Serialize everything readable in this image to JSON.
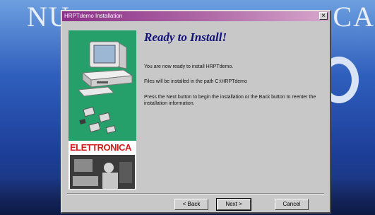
{
  "background": {
    "title_left": "NU",
    "title_right": "CA"
  },
  "dialog": {
    "title": "HRPTdemo Installation",
    "close_glyph": "×",
    "heading": "Ready to Install!",
    "paragraphs": [
      "You are now ready to install HRPTdemo.",
      "Files will be installed in the path  C:\\HRPTdemo",
      "Press the Next button to begin the installation or the Back button to reenter the installation information."
    ],
    "magazine_name": "ELETTRONICA",
    "buttons": {
      "back": "< Back",
      "next": "Next >",
      "cancel": "Cancel"
    }
  },
  "colors": {
    "titlebar_start": "#8a2f88",
    "heading": "#12127a",
    "panel_green": "#26a06a",
    "magazine_red": "#d01d1d"
  },
  "icons": [
    "computer-illustration",
    "chip-icon",
    "close-icon"
  ]
}
